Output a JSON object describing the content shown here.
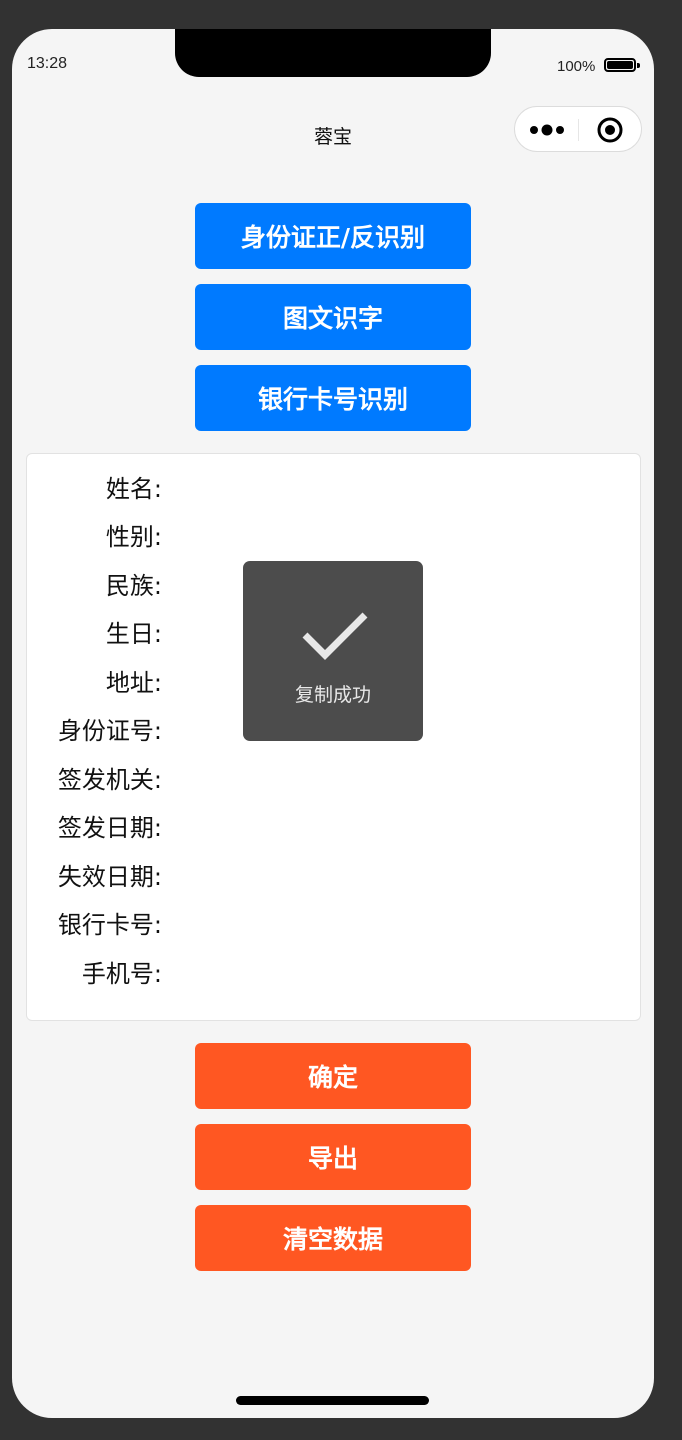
{
  "status_bar": {
    "time": "13:28",
    "battery": "100%"
  },
  "nav": {
    "title": "蓉宝",
    "more_icon": "more-dots-icon",
    "close_icon": "target-close-icon"
  },
  "actions_top": {
    "id_card": "身份证正/反识别",
    "image_text": "图文识字",
    "bank_card": "银行卡号识别"
  },
  "fields": [
    {
      "label": "姓名:",
      "value": ""
    },
    {
      "label": "性别:",
      "value": ""
    },
    {
      "label": "民族:",
      "value": ""
    },
    {
      "label": "生日:",
      "value": ""
    },
    {
      "label": "地址:",
      "value": ""
    },
    {
      "label": "身份证号:",
      "value": ""
    },
    {
      "label": "签发机关:",
      "value": ""
    },
    {
      "label": "签发日期:",
      "value": ""
    },
    {
      "label": "失效日期:",
      "value": ""
    },
    {
      "label": "银行卡号:",
      "value": ""
    },
    {
      "label": "手机号:",
      "value": ""
    }
  ],
  "toast": {
    "icon": "checkmark-icon",
    "text": "复制成功"
  },
  "actions_bottom": {
    "confirm": "确定",
    "export": "导出",
    "clear": "清空数据"
  },
  "colors": {
    "primary_blue": "#007aff",
    "accent_orange": "#ff5722",
    "toast_bg": "#4c4c4c",
    "page_bg": "#f5f5f5"
  }
}
